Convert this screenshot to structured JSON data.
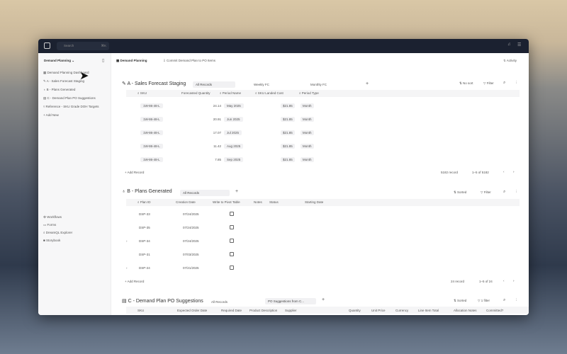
{
  "topbar": {
    "search_placeholder": "Search",
    "shortcut": "⌘K"
  },
  "sidebar": {
    "workspace": "Demand Planning",
    "items": [
      {
        "label": "Demand Planning Dashboard",
        "icon": "grid-icon"
      },
      {
        "label": "A - Sales Forecast Staging",
        "icon": "pencil-icon"
      },
      {
        "label": "B - Plans Generated",
        "icon": "bulb-icon"
      },
      {
        "label": "C - Demand Plan PO Suggestions",
        "icon": "table-icon"
      },
      {
        "label": "Reference - SKU Grade DOH Targets",
        "icon": "filter-icon"
      }
    ],
    "add_new": "Add New",
    "bottom": [
      {
        "label": "Workflows"
      },
      {
        "label": "Forms"
      },
      {
        "label": "DreamQL Explorer"
      },
      {
        "label": "Storybook"
      }
    ]
  },
  "header": {
    "title": "Demand Planning",
    "action": "Commit Demand Plan to PO Items",
    "activity": "Activity"
  },
  "section_a": {
    "title": "A - Sales Forecast Staging",
    "views": [
      "All Records",
      "Weekly FC",
      "Monthly FC"
    ],
    "sort": "No sort",
    "filter": "Filter",
    "columns": [
      "SKU",
      "Forecasted Quantity",
      "Period Name",
      "SKU Landed Cost",
      "Period Type"
    ],
    "rows": [
      [
        "1W-86-48-L",
        "24.14",
        "May 2025",
        "$21.85",
        "Month"
      ],
      [
        "1W-86-48-L",
        "20.91",
        "Jun 2025",
        "$21.85",
        "Month"
      ],
      [
        "1W-86-48-L",
        "17.07",
        "Jul 2025",
        "$21.85",
        "Month"
      ],
      [
        "1W-86-48-L",
        "11.42",
        "Aug 2025",
        "$21.85",
        "Month"
      ],
      [
        "1W-86-48-L",
        "7.85",
        "Sep 2025",
        "$21.85",
        "Month"
      ]
    ],
    "add_record": "Add Record",
    "record_count": "5182 record",
    "pagination": "1–5 of 5182"
  },
  "section_b": {
    "title": "B - Plans Generated",
    "views": [
      "All Records"
    ],
    "sort": "Sorted",
    "filter": "Filter",
    "columns": [
      "Plan ID",
      "Creation Date",
      "Write to Pivot Table",
      "Notes",
      "Status",
      "Starting Date"
    ],
    "rows": [
      [
        "DSP-33",
        "07/24/2025"
      ],
      [
        "DSP-35",
        "07/24/2025"
      ],
      [
        "DSP-34",
        "07/24/2025"
      ],
      [
        "DSP-31",
        "07/03/2025"
      ],
      [
        "DSP-24",
        "07/21/2025"
      ]
    ],
    "add_record": "Add Record",
    "record_count": "24 record",
    "pagination": "1–5 of 24"
  },
  "section_c": {
    "title": "C - Demand Plan PO Suggestions",
    "views": [
      "All Records",
      "PO Suggestions from C..."
    ],
    "sort": "Sorted",
    "filter": "1 filter",
    "columns": [
      "SKU",
      "Expected Order Date",
      "Required Date",
      "Product Description",
      "Supplier",
      "Quantity",
      "Unit Price",
      "Currency",
      "Line Item Total",
      "Allocation Notes",
      "Committed?"
    ]
  }
}
